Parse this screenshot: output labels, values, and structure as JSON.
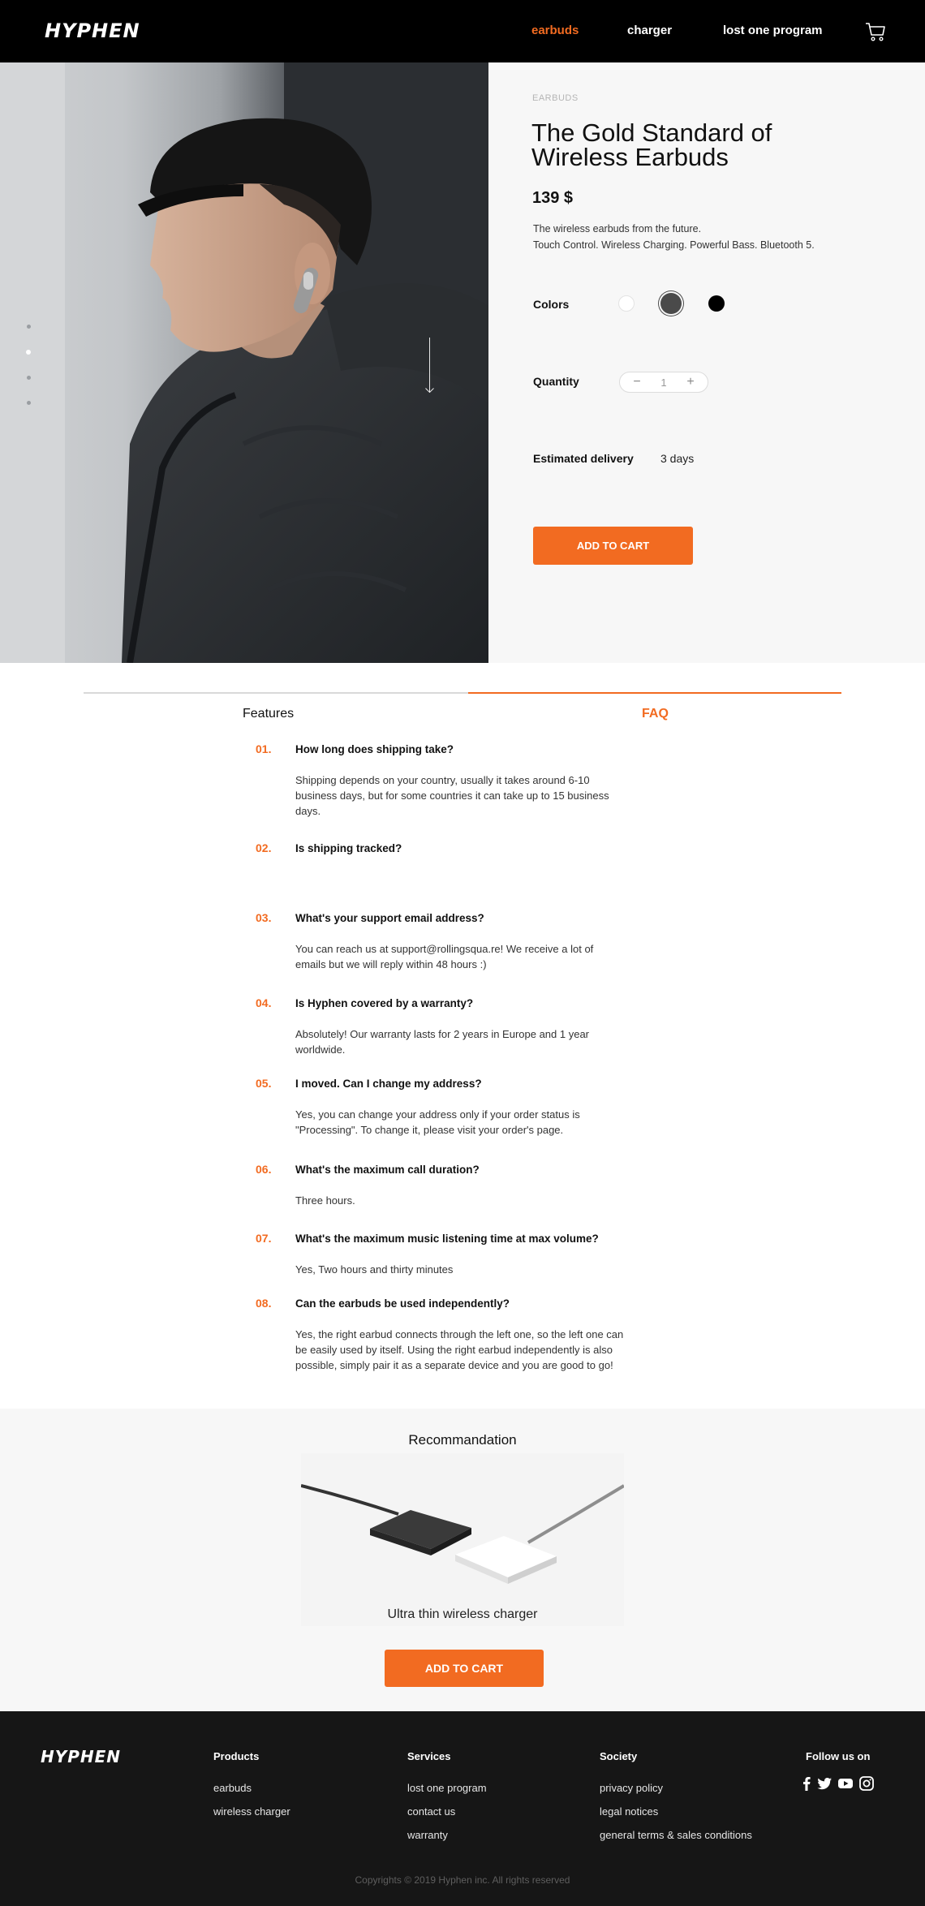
{
  "header": {
    "logo": "HYPHEN",
    "nav": [
      "earbuds",
      "charger",
      "lost one program"
    ],
    "active_nav": "earbuds",
    "accent": "#f26b21"
  },
  "product": {
    "category": "EARBUDS",
    "title": "The Gold Standard of Wireless Earbuds",
    "price": "139 $",
    "description_line1": "The wireless earbuds from the future.",
    "description_line2": "Touch Control. Wireless Charging. Powerful Bass. Bluetooth 5.",
    "colors_label": "Colors",
    "colors": [
      "#ffffff",
      "#4a4a4a",
      "#000000"
    ],
    "selected_color": "#4a4a4a",
    "quantity_label": "Quantity",
    "quantity_minus": "−",
    "quantity_value": "1",
    "quantity_plus": "+",
    "delivery_label": "Estimated delivery",
    "delivery_value": "3 days",
    "add_to_cart": "ADD TO CART",
    "slide_count": 4,
    "active_slide": 2
  },
  "tabs": {
    "features": "Features",
    "faq": "FAQ",
    "active": "FAQ"
  },
  "faq": [
    {
      "num": "01.",
      "q": "How long does shipping take?",
      "a": "Shipping depends on your country, usually it takes around 6-10 business days, but for some countries it can take up to 15 business days."
    },
    {
      "num": "02.",
      "q": "Is shipping tracked?",
      "a": ""
    },
    {
      "num": "03.",
      "q": "What's your support email address?",
      "a": "You can reach us at support@rollingsqua.re! We receive a lot of emails but we will reply within 48 hours :)"
    },
    {
      "num": "04.",
      "q": "Is Hyphen covered by a warranty?",
      "a": "Absolutely! Our warranty lasts for 2 years in Europe and 1 year worldwide."
    },
    {
      "num": "05.",
      "q": "I moved. Can I change my address?",
      "a": "Yes, you can change your address only if your order status is \"Processing\". To change it, please visit your order's page."
    },
    {
      "num": "06.",
      "q": "What's the maximum call duration?",
      "a": "Three hours."
    },
    {
      "num": "07.",
      "q": "What's the maximum music listening time at max volume?",
      "a": "Yes, Two hours and thirty minutes"
    },
    {
      "num": "08.",
      "q": "Can the earbuds be used independently?",
      "a": "Yes, the right earbud connects through the left one, so the left one can be easily used by itself. Using the right earbud independently is also possible, simply pair it as a separate device and you are good to go!"
    }
  ],
  "recommendation": {
    "title": "Recommandation",
    "product_name": "Ultra thin wireless charger",
    "add_to_cart": "ADD TO CART"
  },
  "footer": {
    "logo": "HYPHEN",
    "products": {
      "title": "Products",
      "links": [
        "earbuds",
        "wireless charger"
      ]
    },
    "services": {
      "title": "Services",
      "links": [
        "lost one program",
        "contact us",
        "warranty"
      ]
    },
    "society": {
      "title": "Society",
      "links": [
        "privacy policy",
        "legal notices",
        "general terms & sales conditions"
      ]
    },
    "follow": {
      "title": "Follow us on",
      "icons": [
        "facebook-icon",
        "twitter-icon",
        "youtube-icon",
        "instagram-icon"
      ]
    },
    "copyright": "Copyrights © 2019 Hyphen inc. All rights reserved"
  }
}
